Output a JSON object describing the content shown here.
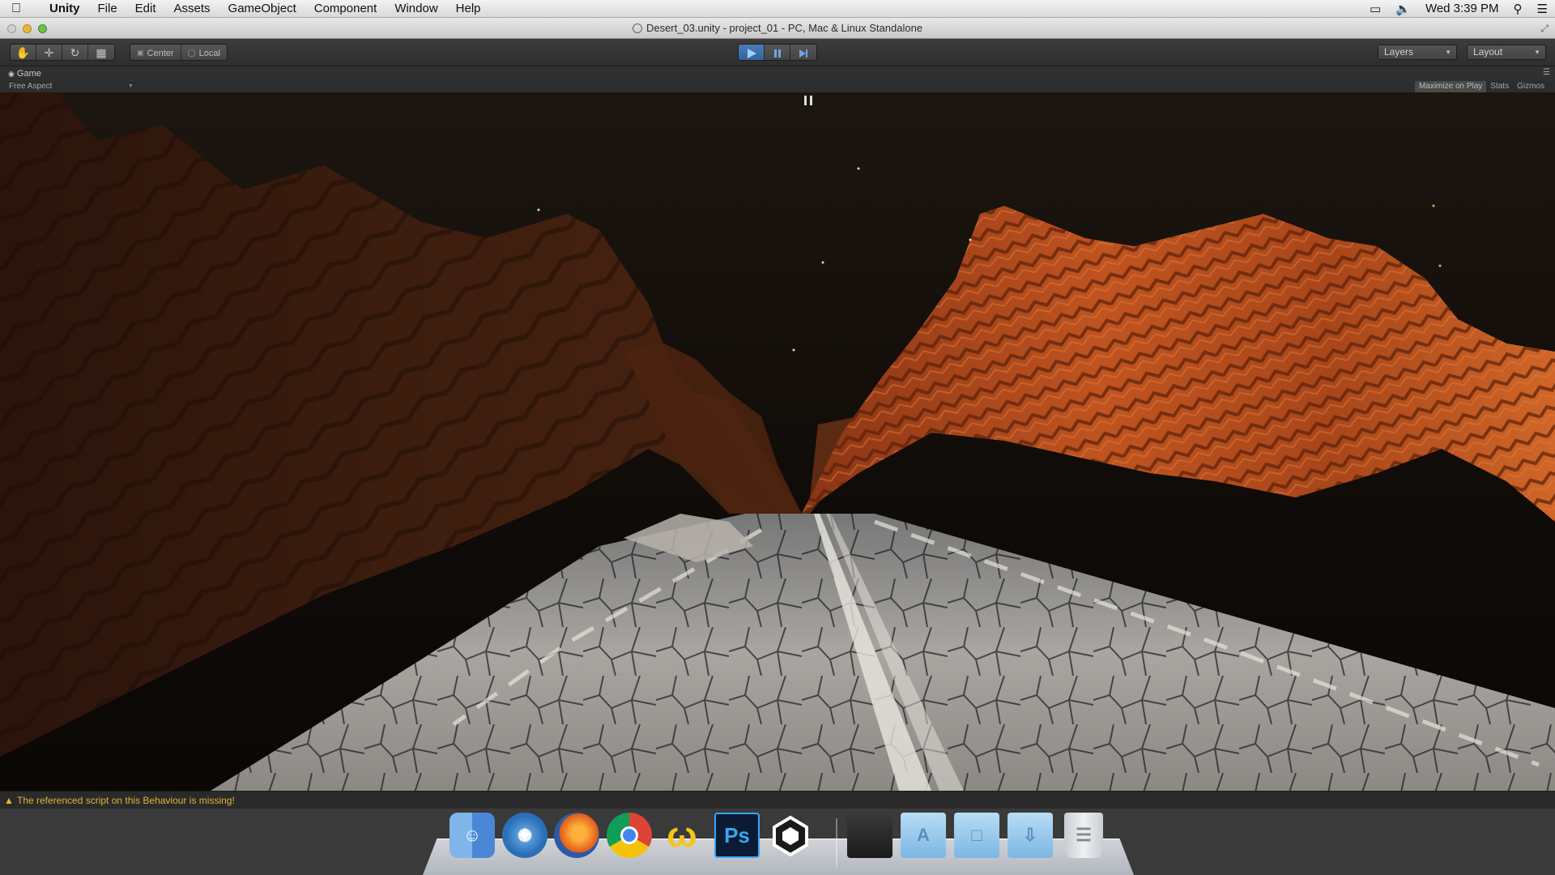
{
  "menubar": {
    "app_name": "Unity",
    "items": [
      "File",
      "Edit",
      "Assets",
      "GameObject",
      "Component",
      "Window",
      "Help"
    ],
    "clock": "Wed 3:39 PM"
  },
  "window": {
    "title": "Desert_03.unity - project_01 - PC, Mac & Linux Standalone"
  },
  "toolbar": {
    "pivot_center_label": "Center",
    "pivot_local_label": "Local",
    "layers_label": "Layers",
    "layout_label": "Layout"
  },
  "game_panel": {
    "tab_label": "Game",
    "aspect_label": "Free Aspect",
    "maximize_label": "Maximize on Play",
    "stats_label": "Stats",
    "gizmos_label": "Gizmos"
  },
  "status": {
    "message": "The referenced script on this Behaviour is missing!"
  },
  "dock": {
    "icons": [
      "finder-icon",
      "safari-icon",
      "firefox-icon",
      "chrome-icon",
      "app-icon",
      "photoshop-icon",
      "unity-icon",
      "folder-icon",
      "applications-folder-icon",
      "documents-folder-icon",
      "downloads-folder-icon",
      "trash-icon"
    ],
    "photoshop_label": "Ps"
  },
  "colors": {
    "accent_play": "#4d7bb8",
    "warning": "#e0b53a",
    "canyon_orange": "#b8501f"
  }
}
